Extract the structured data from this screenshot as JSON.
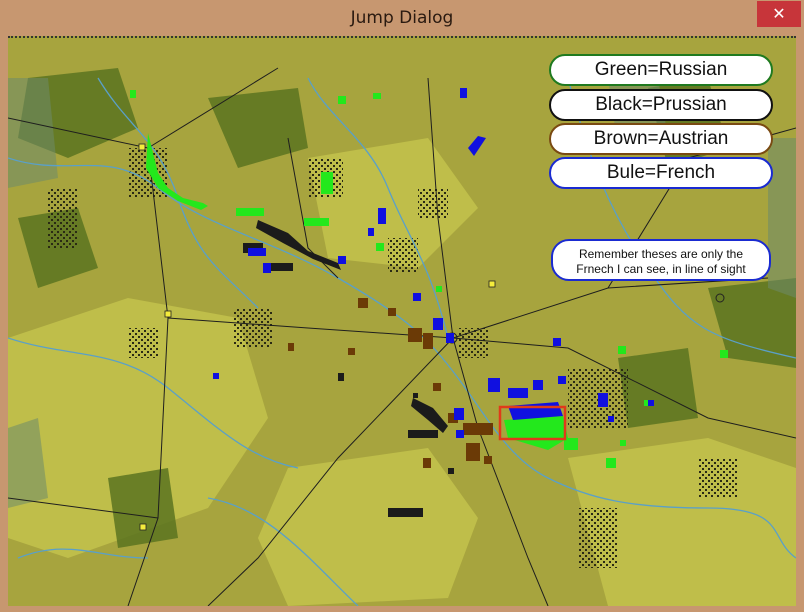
{
  "window": {
    "title": "Jump Dialog",
    "close_glyph": "✕"
  },
  "legend": {
    "items": [
      {
        "label": "Green=Russian",
        "border_color": "#1f7a1f"
      },
      {
        "label": "Black=Prussian",
        "border_color": "#111111"
      },
      {
        "label": "Brown=Austrian",
        "border_color": "#7a4a12"
      },
      {
        "label": "Bule=French",
        "border_color": "#1a2bd1"
      }
    ]
  },
  "note": {
    "line1": "Remember theses are only the",
    "line2": "Frnech I can see, in line of sight"
  },
  "colors": {
    "russian": "#23e81c",
    "prussian": "#1b1b1b",
    "austrian": "#6b3a06",
    "french": "#1010e0",
    "town": "#f4ec3c",
    "selection": "#e03a1a",
    "terrain_base": "#a7a43e",
    "forest": "#4d6a1e",
    "river": "#5aa0c8",
    "road": "#1e1e1e"
  }
}
